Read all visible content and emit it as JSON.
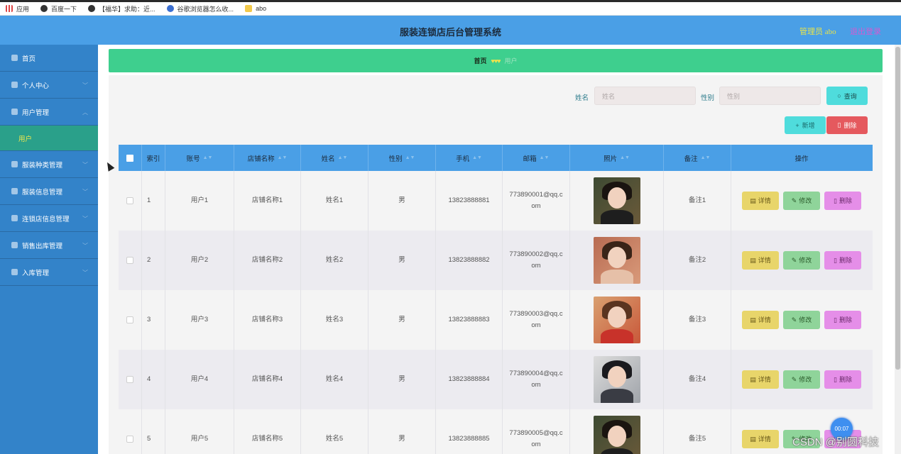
{
  "bookmarks": {
    "items": [
      {
        "label": "应用",
        "icon": "apps-icon"
      },
      {
        "label": "百度一下",
        "icon": "globe-icon"
      },
      {
        "label": "【福华】求助：近...",
        "icon": "globe-icon"
      },
      {
        "label": "谷歌浏览器怎么收...",
        "icon": "paw-icon"
      },
      {
        "label": "abo",
        "icon": "folder-icon"
      }
    ]
  },
  "header": {
    "title": "服装连锁店后台管理系统",
    "admin": "管理员 abo",
    "logout": "退出登录"
  },
  "sidebar": {
    "items": [
      {
        "label": "首页",
        "icon": "home-icon",
        "has_arrow": false
      },
      {
        "label": "个人中心",
        "icon": "user-icon",
        "has_arrow": true
      },
      {
        "label": "用户管理",
        "icon": "user-manage-icon",
        "has_arrow": true
      },
      {
        "label": "服装种类管理",
        "icon": "category-icon",
        "has_arrow": true
      },
      {
        "label": "服装信息管理",
        "icon": "clothes-icon",
        "has_arrow": true
      },
      {
        "label": "连锁店信息管理",
        "icon": "globe-icon",
        "has_arrow": true
      },
      {
        "label": "销售出库管理",
        "icon": "sales-icon",
        "has_arrow": true
      },
      {
        "label": "入库管理",
        "icon": "chart-icon",
        "has_arrow": true
      }
    ],
    "sub_item": "用户"
  },
  "breadcrumb": {
    "home": "首页",
    "separator": "♥♥♥",
    "current": "用户"
  },
  "search": {
    "name_label": "姓名",
    "name_placeholder": "姓名",
    "gender_label": "性别",
    "gender_placeholder": "性别",
    "query_button": "查询"
  },
  "actions": {
    "add": "新增",
    "delete": "删除"
  },
  "table": {
    "headers": [
      "索引",
      "账号",
      "店铺名称",
      "姓名",
      "性别",
      "手机",
      "邮箱",
      "照片",
      "备注",
      "操作"
    ],
    "rows": [
      {
        "index": "1",
        "account": "用户1",
        "store": "店铺名称1",
        "name": "姓名1",
        "gender": "男",
        "phone": "13823888881",
        "email": "773890001@qq.com",
        "note": "备注1"
      },
      {
        "index": "2",
        "account": "用户2",
        "store": "店铺名称2",
        "name": "姓名2",
        "gender": "男",
        "phone": "13823888882",
        "email": "773890002@qq.com",
        "note": "备注2"
      },
      {
        "index": "3",
        "account": "用户3",
        "store": "店铺名称3",
        "name": "姓名3",
        "gender": "男",
        "phone": "13823888883",
        "email": "773890003@qq.com",
        "note": "备注3"
      },
      {
        "index": "4",
        "account": "用户4",
        "store": "店铺名称4",
        "name": "姓名4",
        "gender": "男",
        "phone": "13823888884",
        "email": "773890004@qq.com",
        "note": "备注4"
      },
      {
        "index": "5",
        "account": "用户5",
        "store": "店铺名称5",
        "name": "姓名5",
        "gender": "男",
        "phone": "13823888885",
        "email": "773890005@qq.com",
        "note": "备注5"
      }
    ],
    "row_buttons": {
      "detail": "详情",
      "edit": "修改",
      "delete": "删除"
    }
  },
  "overlay": {
    "watermark": "CSDN @别圆科技",
    "timer": "00:07"
  },
  "colors": {
    "header": "#4a9fe6",
    "sidebar": "#3383c9",
    "breadcrumb": "#3ecf8e",
    "accent_yellow": "#e8e34a"
  }
}
